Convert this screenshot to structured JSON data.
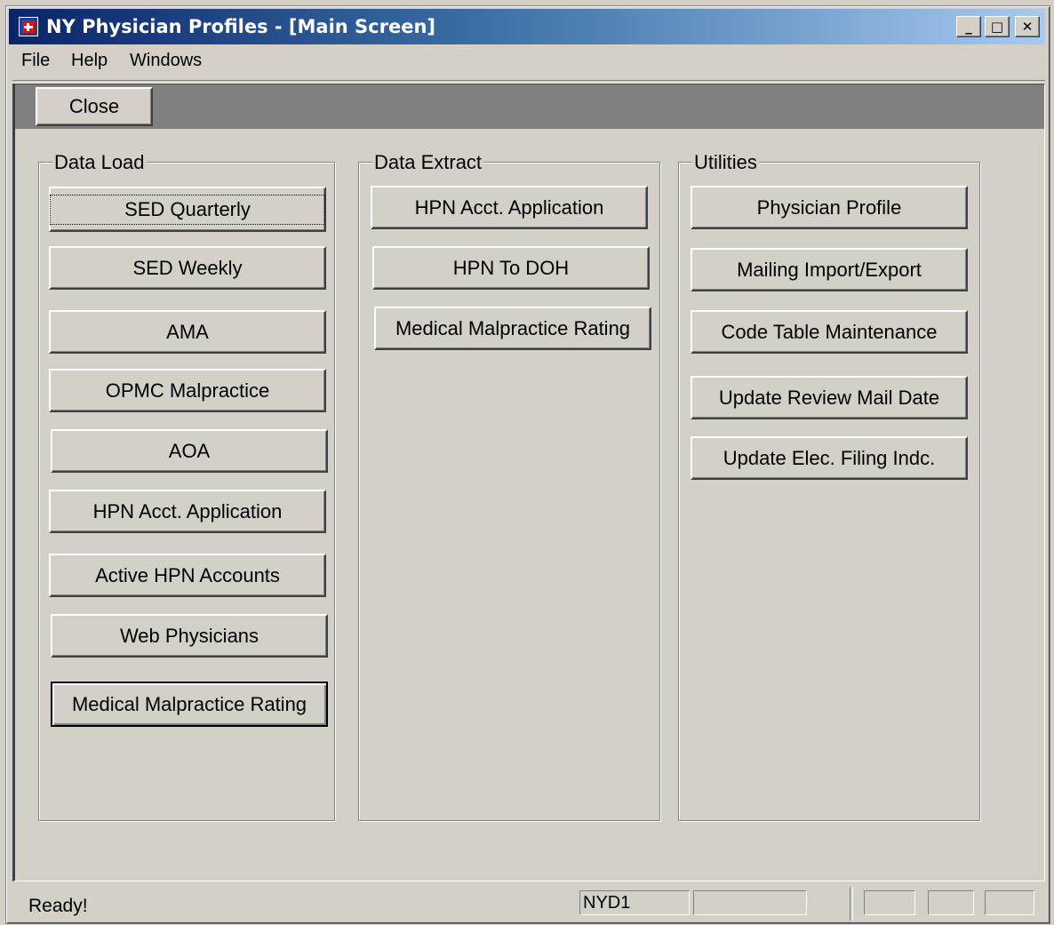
{
  "window": {
    "title": "NY Physician Profiles - [Main Screen]",
    "controls": {
      "minimize": "_",
      "maximize": "□",
      "close": "✕"
    }
  },
  "menu": [
    "File",
    "Help",
    "Windows"
  ],
  "toolbar": {
    "close_label": "Close"
  },
  "groups": {
    "data_load": {
      "label": "Data Load",
      "buttons": [
        "SED Quarterly",
        "SED Weekly",
        "AMA",
        "OPMC Malpractice",
        "AOA",
        "HPN Acct. Application",
        "Active HPN Accounts",
        "Web Physicians",
        "Medical Malpractice Rating"
      ]
    },
    "data_extract": {
      "label": "Data Extract",
      "buttons": [
        "HPN Acct. Application",
        "HPN To DOH",
        "Medical Malpractice Rating"
      ]
    },
    "utilities": {
      "label": "Utilities",
      "buttons": [
        "Physician Profile",
        "Mailing Import/Export",
        "Code Table Maintenance",
        "Update Review Mail Date",
        "Update Elec. Filing Indc."
      ]
    }
  },
  "status": {
    "text": "Ready!",
    "pane1": "NYD1",
    "pane2": ""
  }
}
